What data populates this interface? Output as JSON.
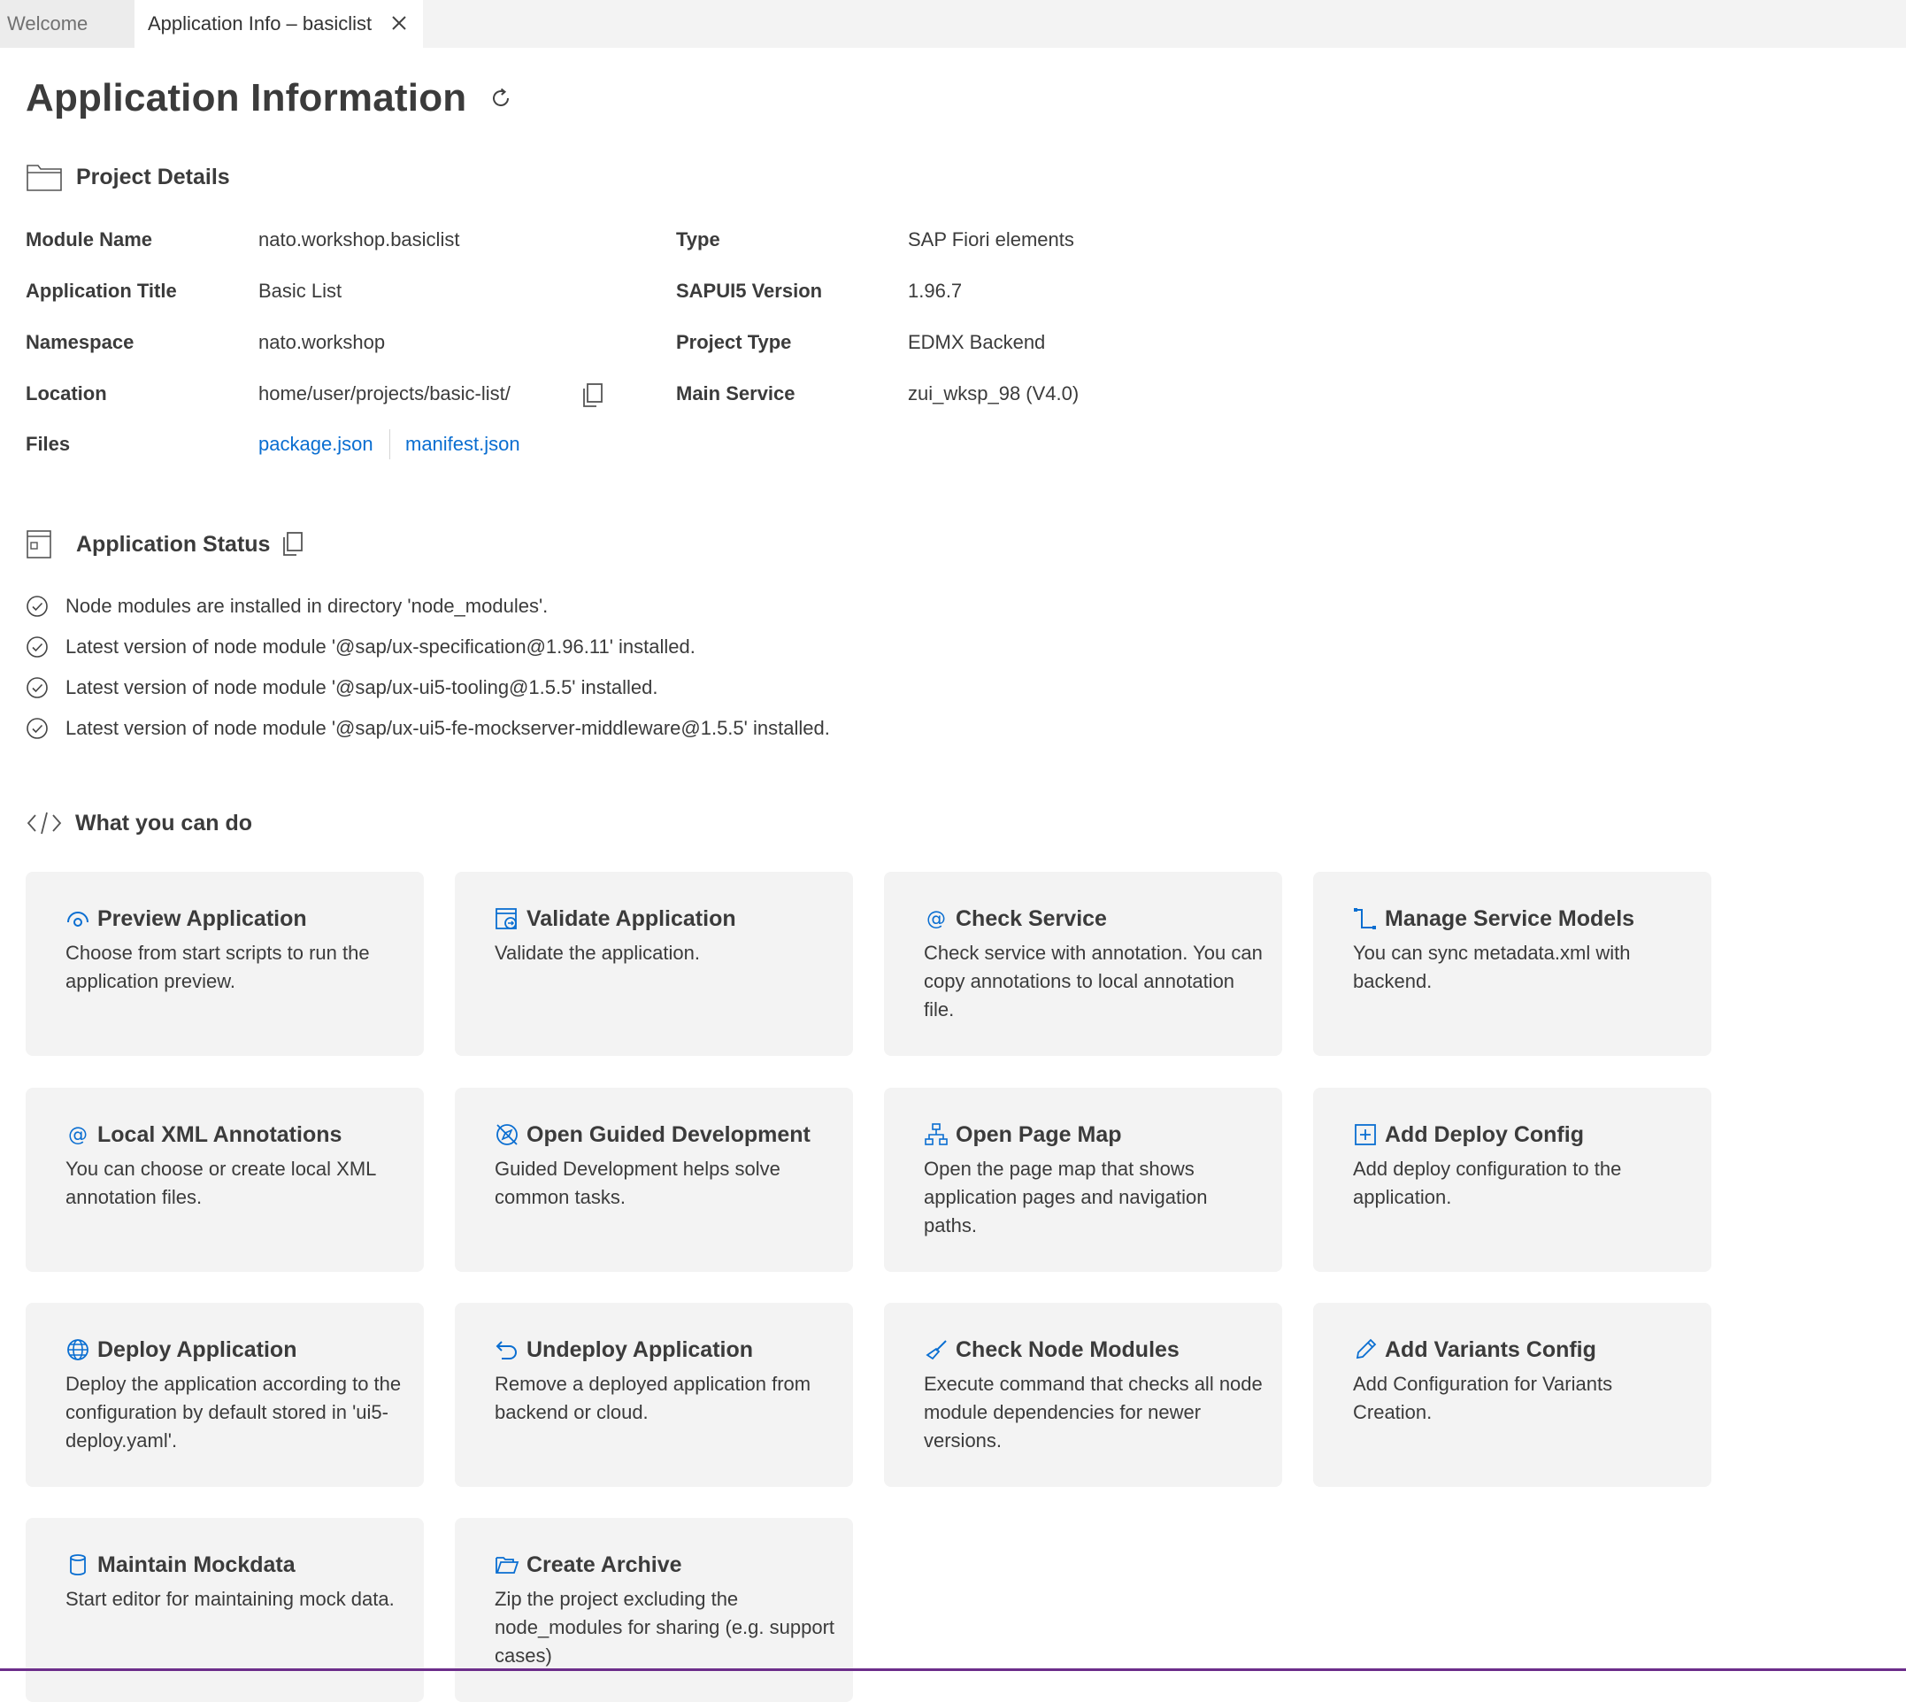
{
  "tabs": [
    {
      "label": "Welcome"
    },
    {
      "label": "Application Info – basiclist"
    }
  ],
  "page": {
    "title": "Application Information"
  },
  "project_details": {
    "title": "Project Details",
    "fields": {
      "module_name": {
        "label": "Module Name",
        "value": "nato.workshop.basiclist"
      },
      "app_title": {
        "label": "Application Title",
        "value": "Basic List"
      },
      "namespace": {
        "label": "Namespace",
        "value": "nato.workshop"
      },
      "location": {
        "label": "Location",
        "value": "home/user/projects/basic-list/"
      },
      "files": {
        "label": "Files",
        "links": [
          "package.json",
          "manifest.json"
        ]
      },
      "type": {
        "label": "Type",
        "value": "SAP Fiori elements"
      },
      "ui5_version": {
        "label": "SAPUI5 Version",
        "value": "1.96.7"
      },
      "project_type": {
        "label": "Project Type",
        "value": "EDMX Backend"
      },
      "main_service": {
        "label": "Main Service",
        "value": "zui_wksp_98 (V4.0)"
      }
    }
  },
  "app_status": {
    "title": "Application Status",
    "items": [
      "Node modules are installed in directory 'node_modules'.",
      "Latest version of node module '@sap/ux-specification@1.96.11' installed.",
      "Latest version of node module '@sap/ux-ui5-tooling@1.5.5' installed.",
      "Latest version of node module '@sap/ux-ui5-fe-mockserver-middleware@1.5.5' installed."
    ]
  },
  "actions": {
    "title": "What you can do",
    "cards": [
      {
        "title": "Preview Application",
        "desc": "Choose from start scripts to run the application preview.",
        "icon": "preview-icon"
      },
      {
        "title": "Validate Application",
        "desc": "Validate the application.",
        "icon": "validate-icon"
      },
      {
        "title": "Check Service",
        "desc": "Check service with annotation. You can copy annotations to local annotation file.",
        "icon": "at-icon"
      },
      {
        "title": "Manage Service Models",
        "desc": "You can sync metadata.xml with backend.",
        "icon": "connector-icon"
      },
      {
        "title": "Local XML Annotations",
        "desc": "You can choose or create local XML annotation files.",
        "icon": "at-icon"
      },
      {
        "title": "Open Guided Development",
        "desc": "Guided Development helps solve common tasks.",
        "icon": "compass-icon"
      },
      {
        "title": "Open Page Map",
        "desc": "Open the page map that shows application pages and navigation paths.",
        "icon": "sitemap-icon"
      },
      {
        "title": "Add Deploy Config",
        "desc": "Add deploy configuration to the application.",
        "icon": "add-box-icon"
      },
      {
        "title": "Deploy Application",
        "desc": "Deploy the application according to the configuration by default stored in 'ui5-deploy.yaml'.",
        "icon": "globe-icon"
      },
      {
        "title": "Undeploy Application",
        "desc": "Remove a deployed application from backend or cloud.",
        "icon": "undo-icon"
      },
      {
        "title": "Check Node Modules",
        "desc": "Execute command that checks all node module dependencies for newer versions.",
        "icon": "broom-icon"
      },
      {
        "title": "Add Variants Config",
        "desc": "Add Configuration for Variants Creation.",
        "icon": "pencil-icon"
      },
      {
        "title": "Maintain Mockdata",
        "desc": "Start editor for maintaining mock data.",
        "icon": "database-icon"
      },
      {
        "title": "Create Archive",
        "desc": "Zip the project excluding the node_modules for sharing (e.g. support cases)",
        "icon": "folder-open-icon"
      }
    ]
  },
  "colors": {
    "accent": "#0a6ed1",
    "card_bg": "#f3f3f3",
    "text": "#3b3b3b",
    "bottom_bar": "#6c2d8a"
  }
}
